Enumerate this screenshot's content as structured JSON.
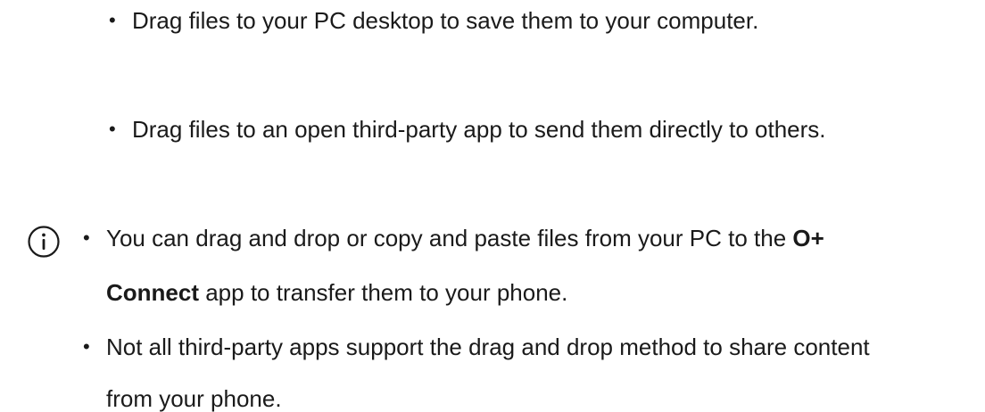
{
  "upper_list": {
    "items": [
      "Drag files to your PC desktop to save them to your computer.",
      "Drag files to an open third-party app to send them directly to others."
    ]
  },
  "note": {
    "icon": "info-icon",
    "items": [
      {
        "before": "You can drag and drop or copy and paste files from your PC to the ",
        "bold": "O+",
        "bold_cont": "Connect",
        "after": " app to transfer them to your phone."
      },
      {
        "line1": "Not all third-party apps support the drag and drop method to share content",
        "line2": "from your phone."
      }
    ]
  },
  "bullet_char": "•"
}
